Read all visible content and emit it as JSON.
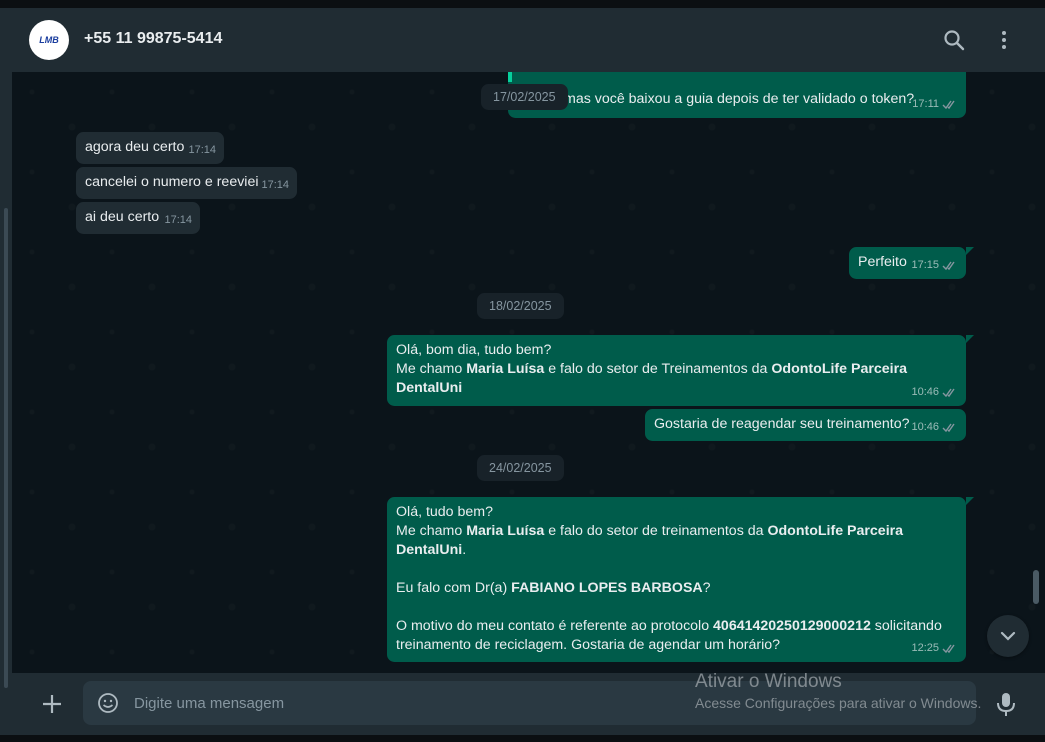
{
  "header": {
    "avatar_text": "LMB",
    "contact_name": "+55 11 99875-5414",
    "icons": [
      "search-icon",
      "menu-dots-icon"
    ]
  },
  "messages": [
    {
      "text": "mas você baixou a guia depois de ter validado o token?",
      "time": "17:11"
    },
    {
      "text": "agora deu certo",
      "time": "17:14"
    },
    {
      "text": "cancelei o numero e reeviei",
      "time": "17:14"
    },
    {
      "text": "ai deu certo",
      "time": "17:14"
    },
    {
      "text": "Perfeito",
      "time": "17:15"
    },
    {
      "l1": "Olá, bom dia, tudo bem?",
      "l2a": "Me chamo ",
      "l2b": "Maria Luísa",
      "l2c": " e falo do setor de Treinamentos da ",
      "l2d": "OdontoLife Parceira",
      "l3": "DentalUni",
      "time": "10:46"
    },
    {
      "text": "Gostaria de reagendar seu treinamento?",
      "time": "10:46"
    },
    {
      "l1": "Olá, tudo bem?",
      "l2a": "Me chamo ",
      "l2b": "Maria Luísa",
      "l2c": " e falo do setor de treinamentos da ",
      "l2d": "OdontoLife Parceira",
      "l3a": "DentalUni",
      "l3b": ".",
      "l4a": "Eu falo com Dr(a) ",
      "l4b": "FABIANO LOPES BARBOSA",
      "l4c": "?",
      "l5a": "O motivo do meu contato é referente ao protocolo ",
      "l5b": "40641420250129000212",
      "l5c": " solicitando",
      "l6": "treinamento de reciclagem. Gostaria de agendar um horário?",
      "time": "12:25"
    }
  ],
  "dates": [
    "17/02/2025",
    "18/02/2025",
    "24/02/2025"
  ],
  "footer": {
    "placeholder": "Digite uma mensagem"
  },
  "watermark": {
    "title": "Ativar o Windows",
    "subtitle": "Acesse Configurações para ativar o Windows."
  },
  "colors": {
    "outgoing_bubble": "#005c4b",
    "incoming_bubble": "#202c33",
    "chat_background": "#0b141a",
    "tick_read": "#53bdeb"
  }
}
